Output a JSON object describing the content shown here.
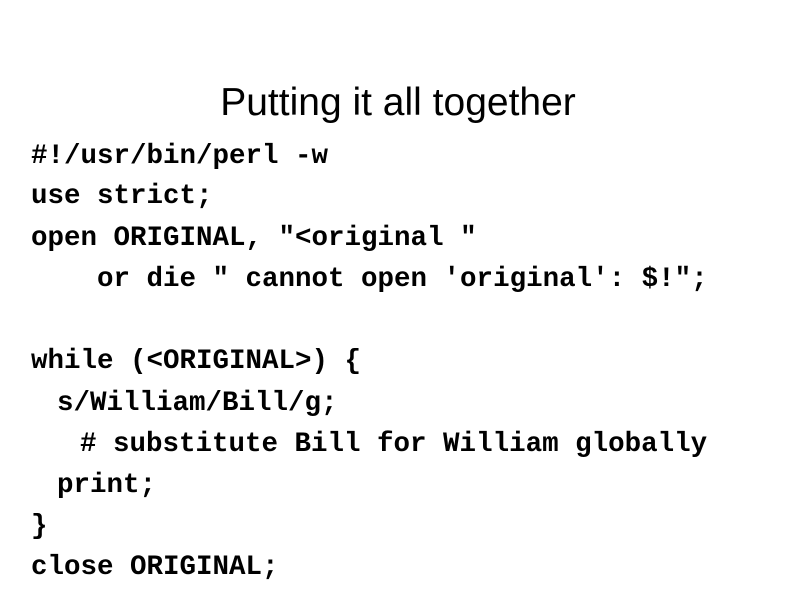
{
  "slide": {
    "title": "Putting it all together",
    "code_lines": [
      "#!/usr/bin/perl -w",
      "use strict;",
      "open ORIGINAL, \"<original \"",
      "or die \" cannot open 'original': $!\";",
      "",
      "while (<ORIGINAL>) {",
      "s/William/Bill/g;",
      "# substitute Bill for William globally",
      "print;",
      "}",
      "close ORIGINAL;"
    ]
  }
}
